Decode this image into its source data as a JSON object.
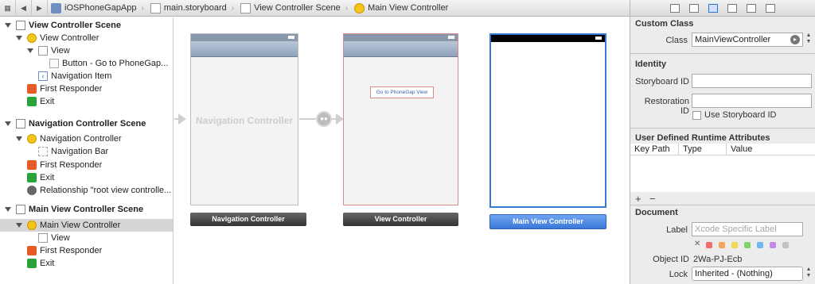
{
  "jumpbar": {
    "crumbs": [
      "iOSPhoneGapApp",
      "main.storyboard",
      "View Controller Scene",
      "Main View Controller"
    ]
  },
  "outline": {
    "rows": [
      {
        "label": "View Controller Scene"
      },
      {
        "label": "View Controller"
      },
      {
        "label": "View"
      },
      {
        "label": "Button - Go to PhoneGap..."
      },
      {
        "label": "Navigation Item"
      },
      {
        "label": "First Responder"
      },
      {
        "label": "Exit"
      },
      {
        "label": "Navigation Controller Scene"
      },
      {
        "label": "Navigation Controller"
      },
      {
        "label": "Navigation Bar"
      },
      {
        "label": "First Responder"
      },
      {
        "label": "Exit"
      },
      {
        "label": "Relationship \"root view controlle..."
      },
      {
        "label": "Main View Controller Scene"
      },
      {
        "label": "Main View Controller"
      },
      {
        "label": "View"
      },
      {
        "label": "First Responder"
      },
      {
        "label": "Exit"
      }
    ]
  },
  "canvas": {
    "nav_controller_watermark": "Navigation Controller",
    "button_label": "Go to PhoneGap View",
    "scene_labels": [
      "Navigation Controller",
      "View Controller",
      "Main View Controller"
    ]
  },
  "inspector": {
    "custom_class": {
      "title": "Custom Class",
      "class_label": "Class",
      "class_value": "MainViewController"
    },
    "identity": {
      "title": "Identity",
      "storyboard_id_label": "Storyboard ID",
      "restoration_id_label": "Restoration ID",
      "use_storyboard_id_label": "Use Storyboard ID"
    },
    "runtime": {
      "title": "User Defined Runtime Attributes",
      "columns": [
        "Key Path",
        "Type",
        "Value"
      ],
      "add": "+",
      "remove": "−"
    },
    "document": {
      "title": "Document",
      "label_label": "Label",
      "label_placeholder": "Xcode Specific Label",
      "object_id_label": "Object ID",
      "object_id_value": "2Wa-PJ-Ecb",
      "lock_label": "Lock",
      "lock_value": "Inherited - (Nothing)"
    },
    "swatch_colors": [
      "#f26c6c",
      "#f5a65b",
      "#f0d84f",
      "#7fd36b",
      "#6fb6f2",
      "#c08ae6",
      "#c2c2c2"
    ]
  }
}
